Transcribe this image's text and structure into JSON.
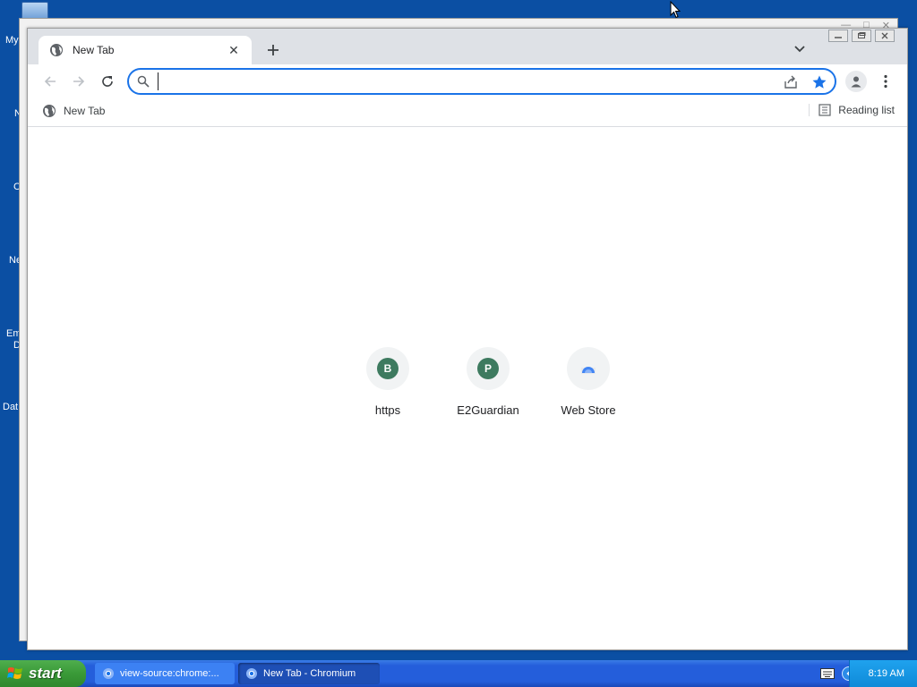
{
  "desktop": {
    "icon_labels": [
      "My",
      "N",
      "C",
      "Ne",
      "Em",
      "D",
      "Dat"
    ]
  },
  "browser": {
    "tab": {
      "title": "New Tab"
    },
    "omnibox": {
      "value": "",
      "placeholder": ""
    },
    "bookmarks_bar": {
      "item_label": "New Tab",
      "reading_list_label": "Reading list"
    },
    "tiles": [
      {
        "letter": "B",
        "label": "https",
        "icon": "letter-icon"
      },
      {
        "letter": "P",
        "label": "E2Guardian",
        "icon": "letter-icon"
      },
      {
        "letter": "",
        "label": "Web Store",
        "icon": "web-store-icon"
      }
    ],
    "colors": {
      "focus_ring": "#1a73e8",
      "tile_letter_bg": "#3d7a5f",
      "tabstrip_bg": "#dee1e6"
    }
  },
  "taskbar": {
    "start_label": "start",
    "tasks": [
      {
        "label": "view-source:chrome:...",
        "active": false
      },
      {
        "label": "New Tab - Chromium",
        "active": true
      }
    ],
    "clock": "8:19 AM"
  }
}
